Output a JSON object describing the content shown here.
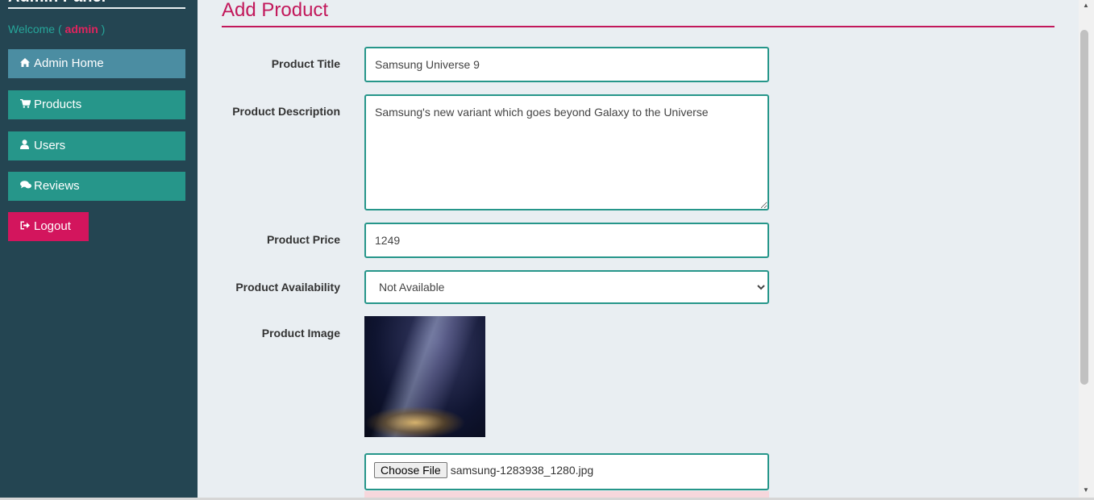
{
  "sidebar": {
    "title": "Admin Panel",
    "welcome_prefix": "Welcome (",
    "welcome_user": "admin",
    "welcome_suffix": ")",
    "items": [
      {
        "label": "Admin Home",
        "icon": "home-icon"
      },
      {
        "label": "Products",
        "icon": "cart-icon"
      },
      {
        "label": "Users",
        "icon": "user-icon"
      },
      {
        "label": "Reviews",
        "icon": "comments-icon"
      }
    ],
    "logout": {
      "label": "Logout",
      "icon": "sign-out-icon"
    }
  },
  "main": {
    "title": "Add Product",
    "form": {
      "title_label": "Product Title",
      "title_value": "Samsung Universe 9",
      "description_label": "Product Description",
      "description_value": "Samsung's new variant which goes beyond Galaxy to the Universe",
      "price_label": "Product Price",
      "price_value": "1249",
      "availability_label": "Product Availability",
      "availability_selected": "Not Available",
      "image_label": "Product Image",
      "choose_file_label": "Choose File",
      "file_name": "samsung-1283938_1280.jpg"
    }
  },
  "colors": {
    "sidebar_bg": "#244552",
    "accent_teal": "#26968a",
    "accent_pink": "#c2185b",
    "logout_bg": "#d3155d"
  }
}
